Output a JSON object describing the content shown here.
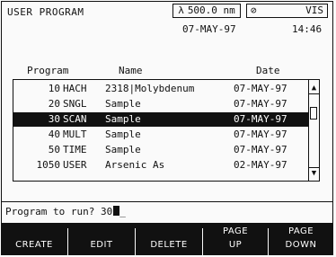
{
  "header": {
    "title": "USER PROGRAM",
    "wavelength_symbol": "λ",
    "wavelength": "500.0 nm",
    "status_symbol": "⊘",
    "status_text": "VIS",
    "date": "07-MAY-97",
    "time": "14:46"
  },
  "table": {
    "columns": [
      "Program",
      "Name",
      "Date"
    ],
    "rows": [
      {
        "num": "10",
        "type": "HACH",
        "name": "2318|Molybdenum",
        "date": "07-MAY-97"
      },
      {
        "num": "20",
        "type": "SNGL",
        "name": "Sample",
        "date": "07-MAY-97"
      },
      {
        "num": "30",
        "type": "SCAN",
        "name": "Sample",
        "date": "07-MAY-97"
      },
      {
        "num": "40",
        "type": "MULT",
        "name": "Sample",
        "date": "07-MAY-97"
      },
      {
        "num": "50",
        "type": "TIME",
        "name": "Sample",
        "date": "07-MAY-97"
      },
      {
        "num": "1050",
        "type": "USER",
        "name": "Arsenic As",
        "date": "02-MAY-97"
      }
    ],
    "selected_index": 2,
    "scroll_up_glyph": "▲",
    "scroll_down_glyph": "▼"
  },
  "prompt": {
    "label": "Program to run?",
    "value": "30",
    "trailing": "_"
  },
  "softkeys": [
    {
      "line1": "",
      "line2": "CREATE"
    },
    {
      "line1": "",
      "line2": "EDIT"
    },
    {
      "line1": "",
      "line2": "DELETE"
    },
    {
      "line1": "PAGE",
      "line2": "UP"
    },
    {
      "line1": "PAGE",
      "line2": "DOWN"
    }
  ]
}
